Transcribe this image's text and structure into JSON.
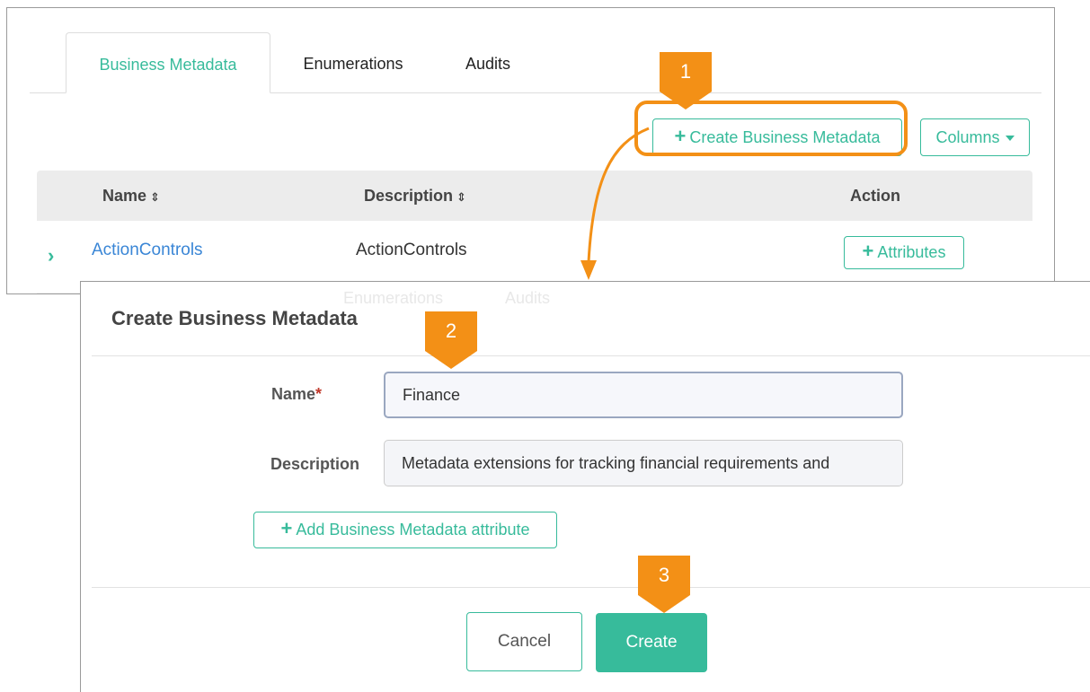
{
  "tabs": [
    {
      "label": "Business Metadata",
      "active": true
    },
    {
      "label": "Enumerations",
      "active": false
    },
    {
      "label": "Audits",
      "active": false
    }
  ],
  "toolbar": {
    "create_label": "Create Business Metadata",
    "columns_label": "Columns"
  },
  "table": {
    "headers": {
      "name": "Name",
      "description": "Description",
      "action": "Action"
    },
    "rows": [
      {
        "name": "ActionControls",
        "description": "ActionControls",
        "action_label": "Attributes"
      }
    ]
  },
  "callouts": [
    "1",
    "2",
    "3"
  ],
  "modal": {
    "ghost_tabs": [
      "Enumerations",
      "Audits"
    ],
    "title": "Create Business Metadata",
    "name_label": "Name",
    "required_mark": "*",
    "name_value": "Finance",
    "description_label": "Description",
    "description_value": "Metadata extensions for tracking financial requirements and",
    "add_attribute_label": "Add Business Metadata attribute",
    "cancel_label": "Cancel",
    "create_label": "Create"
  },
  "colors": {
    "accent": "#37bb9b",
    "callout": "#f39016",
    "link": "#3a86d6"
  }
}
